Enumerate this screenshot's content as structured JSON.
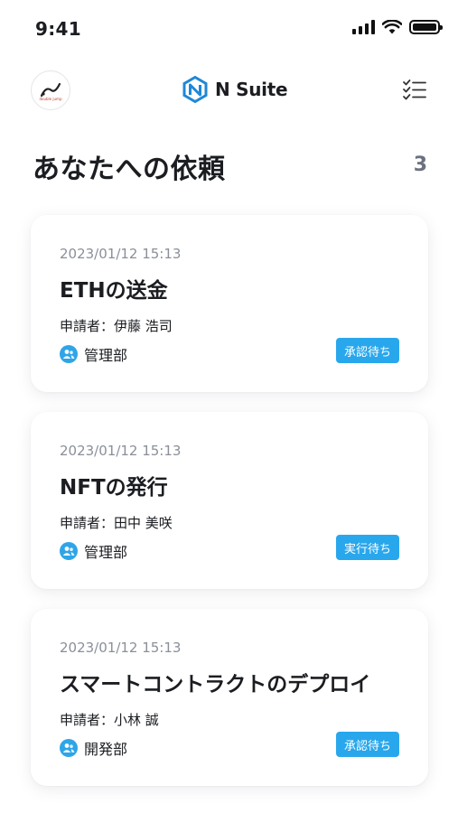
{
  "status_bar": {
    "time": "9:41"
  },
  "header": {
    "brand_name": "N Suite",
    "avatar_logo_text": "double jump",
    "brand_color": "#1e88d6"
  },
  "section": {
    "title": "あなたへの依頼",
    "count": "3"
  },
  "requests": [
    {
      "date": "2023/01/12 15:13",
      "title": "ETHの送金",
      "applicant": "申請者：伊藤 浩司",
      "department": "管理部",
      "status": "承認待ち"
    },
    {
      "date": "2023/01/12 15:13",
      "title": "NFTの発行",
      "applicant": "申請者：田中 美咲",
      "department": "管理部",
      "status": "実行待ち"
    },
    {
      "date": "2023/01/12 15:13",
      "title": "スマートコントラクトのデプロイ",
      "applicant": "申請者：小林 誠",
      "department": "開発部",
      "status": "承認待ち"
    }
  ],
  "colors": {
    "accent": "#29a7ec",
    "text": "#1b1d21",
    "muted": "#8a8f99"
  },
  "icons": [
    "signal-icon",
    "wifi-icon",
    "battery-icon",
    "nsuite-logo-icon",
    "checklist-icon",
    "user-group-icon"
  ]
}
